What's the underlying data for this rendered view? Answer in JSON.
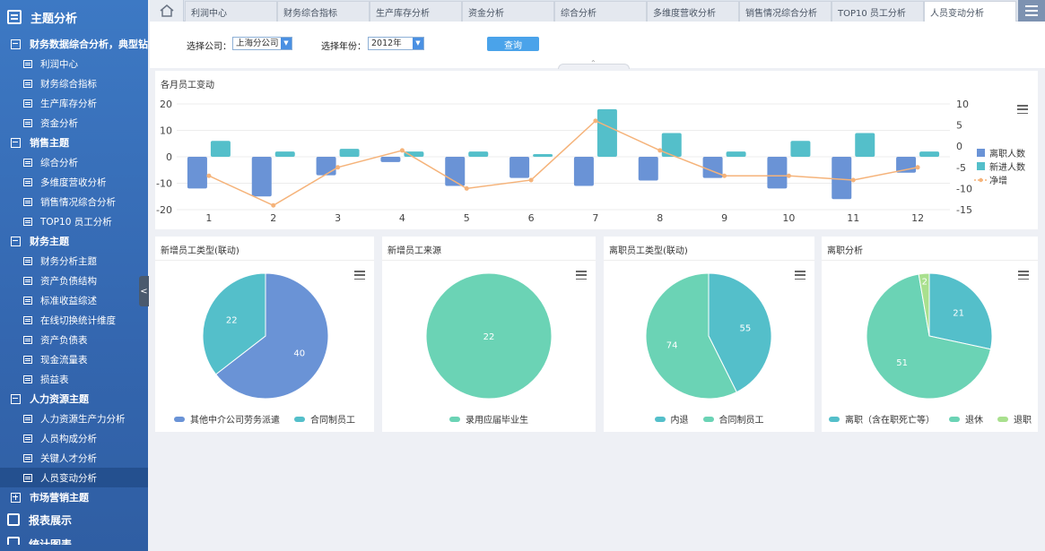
{
  "sidebar": {
    "top_title": "主题分析",
    "groups": [
      {
        "label": "财务数据综合分析，典型钻...",
        "expanded": true,
        "items": [
          "利润中心",
          "财务综合指标",
          "生产库存分析",
          "资金分析"
        ]
      },
      {
        "label": "销售主题",
        "expanded": true,
        "items": [
          "综合分析",
          "多维度营收分析",
          "销售情况综合分析",
          "TOP10 员工分析"
        ]
      },
      {
        "label": "财务主题",
        "expanded": true,
        "items": [
          "财务分析主题",
          "资产负债结构",
          "标准收益综述",
          "在线切换统计维度",
          "资产负债表",
          "现金流量表",
          "损益表"
        ]
      },
      {
        "label": "人力资源主题",
        "expanded": true,
        "items": [
          "人力资源生产力分析",
          "人员构成分析",
          "关键人才分析",
          "人员变动分析"
        ]
      },
      {
        "label": "市场营销主题",
        "expanded": false,
        "items": []
      }
    ],
    "active_item": "人员变动分析",
    "bottom_title": "报表展示",
    "bottom_title_2": "统计图表"
  },
  "tabs": [
    "利润中心",
    "财务综合指标",
    "生产库存分析",
    "资金分析",
    "综合分析",
    "多维度营收分析",
    "销售情况综合分析",
    "TOP10 员工分析",
    "人员变动分析"
  ],
  "active_tab": "人员变动分析",
  "filters": {
    "company_label": "选择公司：",
    "company_value": "上海分公司",
    "year_label": "选择年份：",
    "year_value": "2012年",
    "query_label": "查询"
  },
  "chart_data": [
    {
      "type": "bar",
      "title": "各月员工变动",
      "categories": [
        "1",
        "2",
        "3",
        "4",
        "5",
        "6",
        "7",
        "8",
        "9",
        "10",
        "11",
        "12"
      ],
      "series": [
        {
          "name": "离职人数",
          "kind": "bar",
          "axis": "left",
          "color": "#6a93d6",
          "values": [
            -12,
            -15,
            -7,
            -2,
            -11,
            -8,
            -11,
            -9,
            -8,
            -12,
            -16,
            -6
          ]
        },
        {
          "name": "新进人数",
          "kind": "bar",
          "axis": "left",
          "color": "#54bfca",
          "values": [
            6,
            2,
            3,
            2,
            2,
            1,
            18,
            9,
            2,
            6,
            9,
            2
          ]
        },
        {
          "name": "净增",
          "kind": "line",
          "axis": "right",
          "color": "#f5b37a",
          "values": [
            -7,
            -14,
            -5,
            -1,
            -10,
            -8,
            6,
            -1,
            -7,
            -7,
            -8,
            -5
          ]
        }
      ],
      "ylim_left": [
        -20,
        20
      ],
      "yticks_left": [
        "20",
        "10",
        "0",
        "-10",
        "-20"
      ],
      "ylim_right": [
        -15,
        10
      ],
      "yticks_right": [
        "10",
        "5",
        "0",
        "-5",
        "-10",
        "-15"
      ],
      "grid": true,
      "legend_position": "right"
    },
    {
      "type": "pie",
      "title": "新增员工类型(联动)",
      "slices": [
        {
          "label": "其他中介公司劳务派遣",
          "value": 40,
          "color": "#6a93d6"
        },
        {
          "label": "合同制员工",
          "value": 22,
          "color": "#54bfca"
        }
      ]
    },
    {
      "type": "pie",
      "title": "新增员工来源",
      "slices": [
        {
          "label": "录用应届毕业生",
          "value": 22,
          "color": "#6bd3b5"
        }
      ]
    },
    {
      "type": "pie",
      "title": "离职员工类型(联动)",
      "slices": [
        {
          "label": "内退",
          "value": 55,
          "color": "#54bfca"
        },
        {
          "label": "合同制员工",
          "value": 74,
          "color": "#6bd3b5"
        }
      ]
    },
    {
      "type": "pie",
      "title": "离职分析",
      "slices": [
        {
          "label": "离职（含在职死亡等）",
          "value": 21,
          "color": "#54bfca"
        },
        {
          "label": "退休",
          "value": 51,
          "color": "#6bd3b5"
        },
        {
          "label": "退职",
          "value": 2,
          "color": "#a9e08e"
        }
      ]
    }
  ]
}
